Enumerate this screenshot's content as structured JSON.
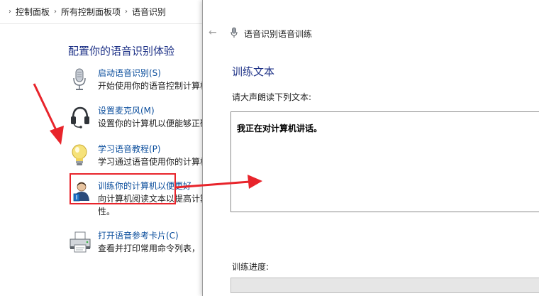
{
  "breadcrumb": {
    "items": [
      "控制面板",
      "所有控制面板项",
      "语音识别"
    ]
  },
  "control_panel": {
    "title": "配置你的语音识别体验",
    "items": [
      {
        "link": "启动语音识别(S)",
        "desc": "开始使用你的语音控制计算机",
        "icon": "microphone-icon"
      },
      {
        "link": "设置麦克风(M)",
        "desc": "设置你的计算机以便能够正确",
        "icon": "headset-icon"
      },
      {
        "link": "学习语音教程(P)",
        "desc": "学习通过语音使用你的计算机",
        "icon": "lightbulb-icon"
      },
      {
        "link": "训练你的计算机以便更好",
        "desc": "向计算机阅读文本以提高计算",
        "desc2": "性。",
        "icon": "user-icon"
      },
      {
        "link": "打开语音参考卡片(C)",
        "desc": "查看并打印常用命令列表，",
        "icon": "printer-icon"
      }
    ]
  },
  "dialog": {
    "header": "语音识别语音训练",
    "title": "训练文本",
    "instruction": "请大声朗读下列文本:",
    "text_content": "我正在对计算机讲话。",
    "progress_label": "训练进度:",
    "progress": 0
  },
  "colors": {
    "heading": "#1e3287",
    "link": "#0a4d9c",
    "annotation": "#e8242b"
  }
}
